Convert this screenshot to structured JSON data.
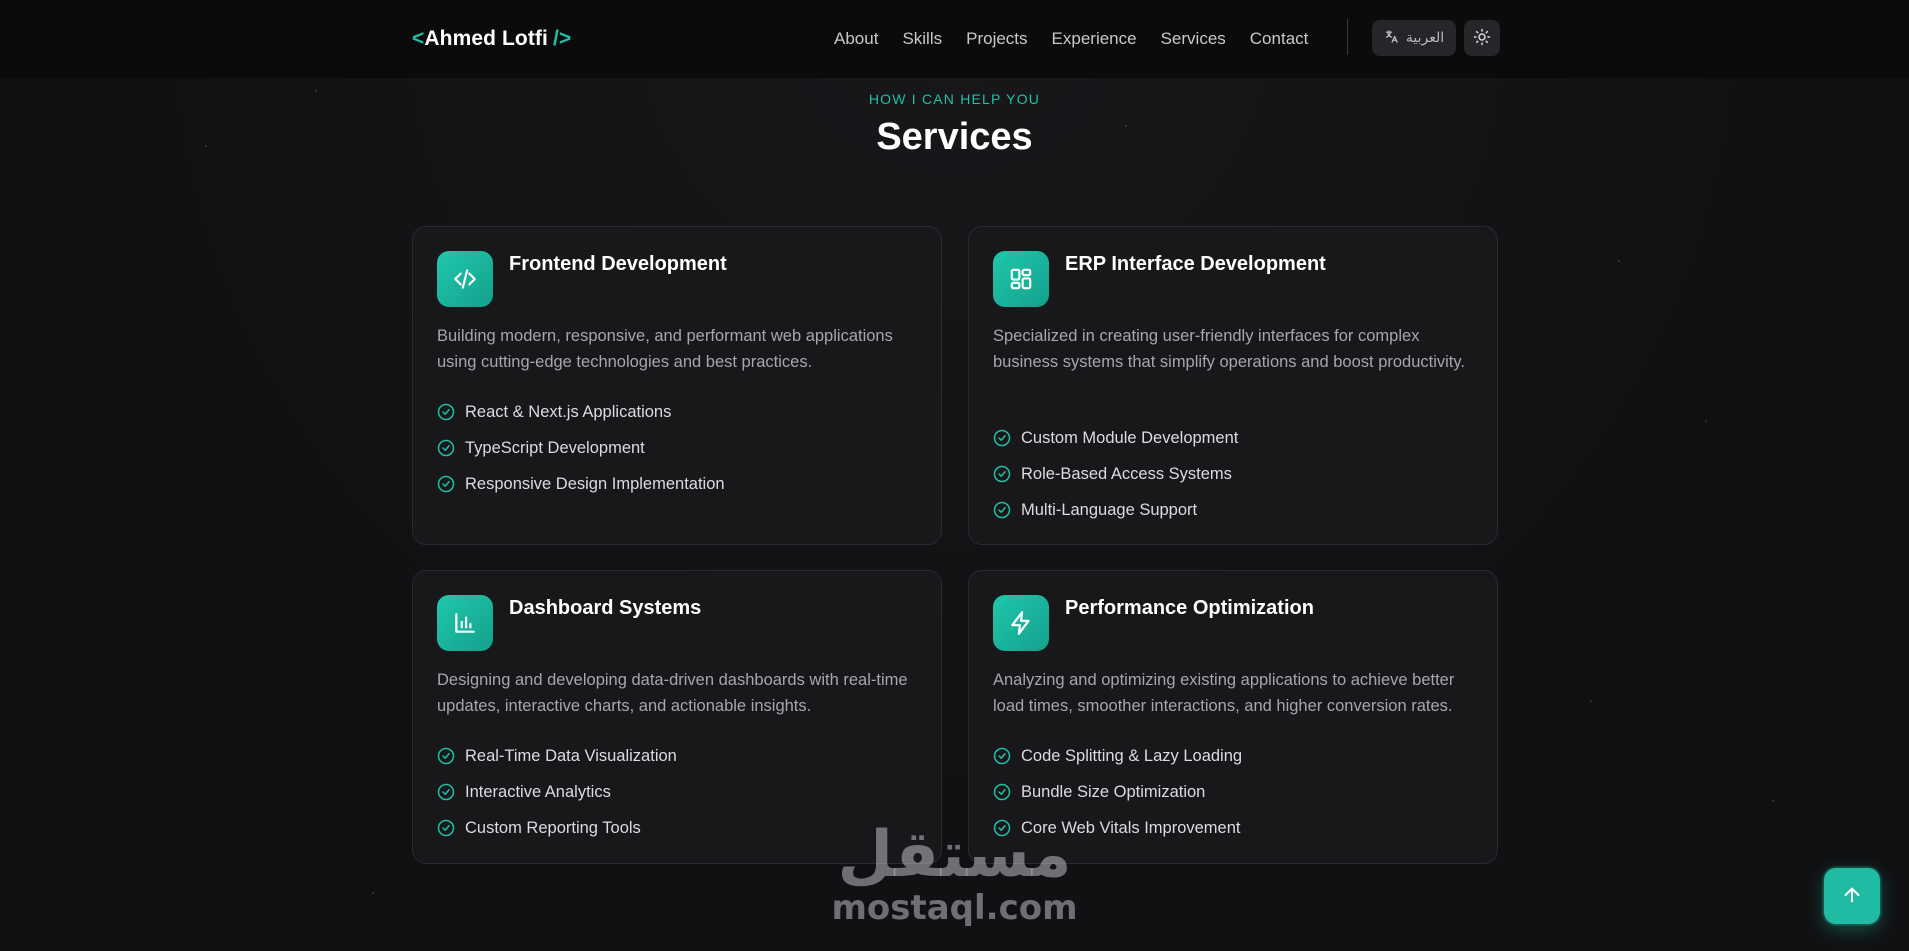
{
  "navbar": {
    "brand_open": "<",
    "brand_name": "Ahmed Lotfi",
    "brand_close": "/>",
    "links": [
      "About",
      "Skills",
      "Projects",
      "Experience",
      "Services",
      "Contact"
    ],
    "language_label": "العربية",
    "language_icon": "translate-icon",
    "theme_icon": "sun-icon"
  },
  "section": {
    "eyebrow": "HOW I CAN HELP YOU",
    "title": "Services"
  },
  "services": [
    {
      "icon": "code-icon",
      "title": "Frontend Development",
      "description": "Building modern, responsive, and performant web applications using cutting-edge technologies and best practices.",
      "features": [
        "React & Next.js Applications",
        "TypeScript Development",
        "Responsive Design Implementation"
      ]
    },
    {
      "icon": "layout-grid-icon",
      "title": "ERP Interface Development",
      "description": "Specialized in creating user-friendly interfaces for complex business systems that simplify operations and boost productivity.",
      "features": [
        "Custom Module Development",
        "Role-Based Access Systems",
        "Multi-Language Support"
      ]
    },
    {
      "icon": "bar-chart-icon",
      "title": "Dashboard Systems",
      "description": "Designing and developing data-driven dashboards with real-time updates, interactive charts, and actionable insights.",
      "features": [
        "Real-Time Data Visualization",
        "Interactive Analytics",
        "Custom Reporting Tools"
      ]
    },
    {
      "icon": "lightning-icon",
      "title": "Performance Optimization",
      "description": "Analyzing and optimizing existing applications to achieve better load times, smoother interactions, and higher conversion rates.",
      "features": [
        "Code Splitting & Lazy Loading",
        "Bundle Size Optimization",
        "Core Web Vitals Improvement"
      ]
    }
  ],
  "watermark": {
    "arabic": "مستقل",
    "latin": "mostaql.com"
  },
  "scroll_top": {
    "icon": "arrow-up-icon"
  },
  "colors": {
    "accent": "#1fc0a6",
    "background": "#111113",
    "card": "#18181b"
  }
}
